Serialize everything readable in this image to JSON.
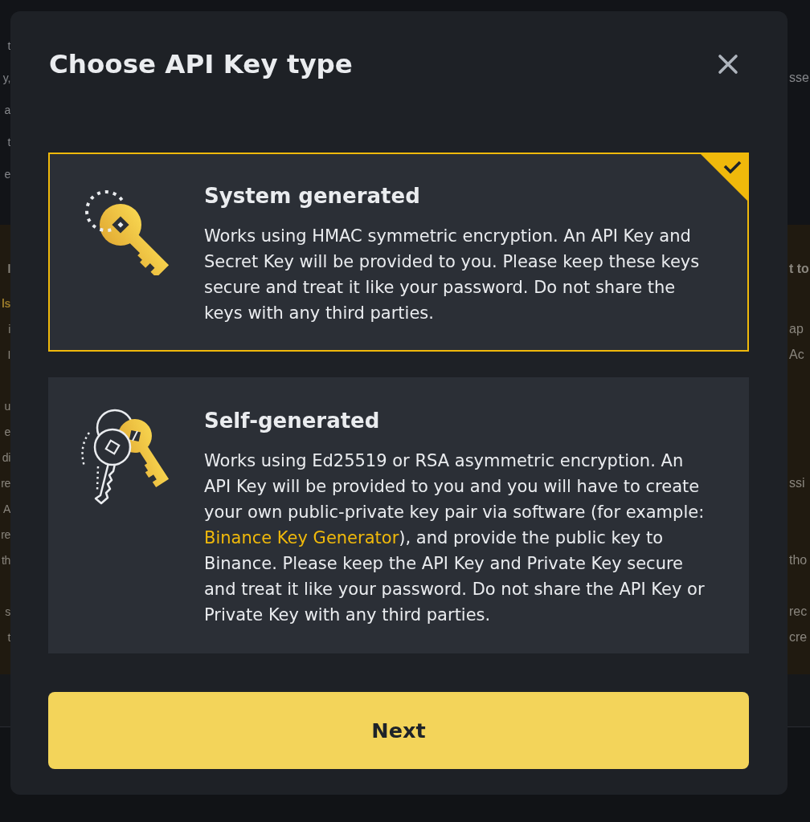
{
  "background_page": {
    "top_lines": [
      {
        "left": "t"
      },
      {
        "left": "y,",
        "right": "sse"
      },
      {
        "left": "a"
      },
      {
        "left": "t"
      },
      {
        "left": "e"
      }
    ],
    "banner": {
      "heading": {
        "left": "l",
        "right": "t to"
      },
      "link_line": {
        "left": "ls"
      },
      "paragraphs": [
        [
          {
            "left": "i",
            "right": "ap"
          },
          {
            "left": "I",
            "right": "Ac"
          }
        ],
        [
          {
            "left": "u"
          },
          {
            "left": "e"
          },
          {
            "left": "di"
          },
          {
            "left": "re",
            "right": "ssi"
          },
          {
            "left": "A"
          },
          {
            "left": "re"
          },
          {
            "left": "th",
            "right": "tho"
          }
        ],
        [
          {
            "left": "s",
            "right": "rec"
          },
          {
            "left": "t",
            "right": "cre"
          }
        ]
      ]
    }
  },
  "dialog": {
    "title": "Choose API Key type",
    "cards": [
      {
        "kind": "system",
        "selected": true,
        "title": "System generated",
        "description": [
          {
            "kind": "text",
            "text": "Works using HMAC symmetric encryption. An API Key and Secret Key will be provided to you. Please keep these keys secure and treat it like your password. Do not share the keys with any third parties."
          }
        ]
      },
      {
        "kind": "self",
        "selected": false,
        "title": "Self-generated",
        "description": [
          {
            "kind": "text",
            "text": "Works using Ed25519 or RSA asymmetric encryption. An API Key will be provided to you and you will have to create your own public-private key pair via software (for example: "
          },
          {
            "kind": "link",
            "text": "Binance Key Generator"
          },
          {
            "kind": "text",
            "text": "), and provide the public key to Binance. Please keep the API Key and Private Key secure and treat it like your password. Do not share the API Key or Private Key with any third parties."
          }
        ]
      }
    ],
    "primary_button": "Next"
  }
}
